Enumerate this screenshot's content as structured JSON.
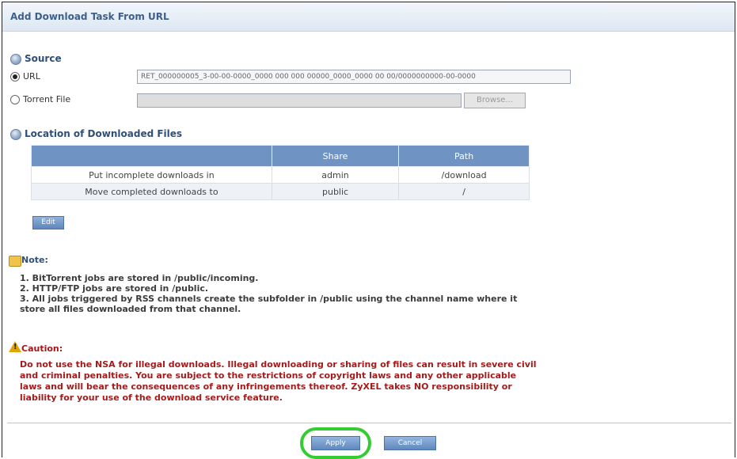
{
  "title": "Add Download Task From URL",
  "source": {
    "heading": "Source",
    "url_label": "URL",
    "url_value": "RET_000000005_3-00-00-0000_0000 000 000 00000_0000_0000 00 00/0000000000-00-0000",
    "torrent_label": "Torrent File",
    "torrent_value": "",
    "browse_label": "Browse...",
    "selected": "URL"
  },
  "location": {
    "heading": "Location of Downloaded Files",
    "columns": [
      "",
      "Share",
      "Path"
    ],
    "rows": [
      {
        "label": "Put incomplete downloads in",
        "share": "admin",
        "path": "/download"
      },
      {
        "label": "Move completed downloads to",
        "share": "public",
        "path": "/"
      }
    ],
    "edit_label": "Edit"
  },
  "note": {
    "title": "Note:",
    "lines": [
      "1. BitTorrent jobs are stored in /public/incoming.",
      "2. HTTP/FTP jobs are stored in /public.",
      "3. All jobs triggered by RSS channels create the subfolder in /public using the channel name where it",
      "store all files downloaded from that channel."
    ]
  },
  "caution": {
    "title": "Caution:",
    "lines": [
      "Do not use the NSA for illegal downloads. Illegal downloading or sharing of files can result in severe civil",
      "and criminal penalties. You are subject to the restrictions of copyright laws and any other applicable",
      "laws and will bear the consequences of any infringements thereof. ZyXEL takes NO responsibility or",
      "liability for your use of the download service feature."
    ]
  },
  "buttons": {
    "apply": "Apply",
    "cancel": "Cancel"
  },
  "colors": {
    "header_blue": "#6f94c3",
    "caution_red": "#a31b1b",
    "highlight_green": "#33cc33"
  }
}
